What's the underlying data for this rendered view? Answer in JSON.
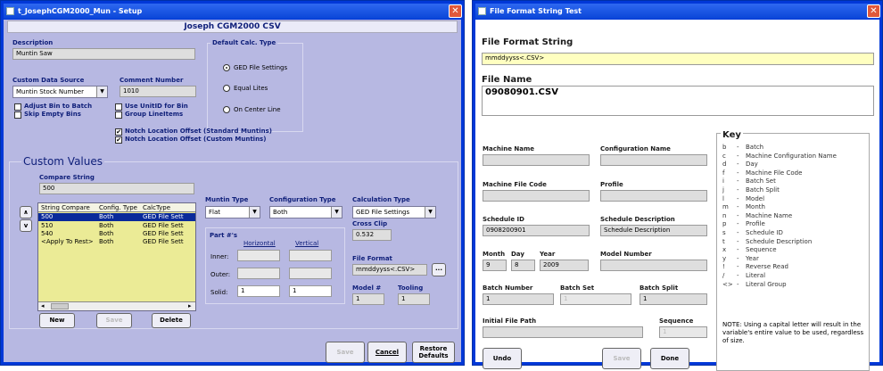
{
  "setup": {
    "title": "t_JosephCGM2000_Mun - Setup",
    "header": "Joseph CGM2000 CSV",
    "description_label": "Description",
    "description_value": "Muntin Saw",
    "default_calc_label": "Default Calc. Type",
    "calc_options": [
      "GED File Settings",
      "Equal Lites",
      "On Center Line"
    ],
    "custom_source_label": "Custom Data Source",
    "custom_source_value": "Muntin Stock Number",
    "comment_label": "Comment Number",
    "comment_value": "1010",
    "checks": [
      "Adjust Bin to Batch",
      "Skip Empty Bins",
      "Use UnitID for Bin",
      "Group LineItems",
      "Notch Location Offset (Standard Muntins)",
      "Notch Location Offset (Custom Muntins)"
    ],
    "custom_values_label": "Custom Values",
    "compare_label": "Compare String",
    "compare_value": "500",
    "grid_headers": [
      "String Compare",
      "Config. Type",
      "CalcType"
    ],
    "grid_rows": [
      [
        "500",
        "Both",
        "GED File Sett"
      ],
      [
        "510",
        "Both",
        "GED File Sett"
      ],
      [
        "540",
        "Both",
        "GED File Sett"
      ],
      [
        "<Apply To Rest>",
        "Both",
        "GED File Sett"
      ]
    ],
    "muntin_type_label": "Muntin Type",
    "muntin_type_value": "Flat",
    "config_type_label": "Configuration Type",
    "config_type_value": "Both",
    "calc_type_label": "Calculation Type",
    "calc_type_value": "GED File Settings",
    "part_label": "Part #'s",
    "horizontal_label": "Horizontal",
    "vertical_label": "Vertical",
    "inner_label": "Inner:",
    "outer_label": "Outer:",
    "solid_label": "Solid:",
    "solid_h": "1",
    "solid_v": "1",
    "cross_clip_label": "Cross Clip",
    "cross_clip_value": "0.532",
    "file_format_label": "File Format",
    "file_format_value": "mmddyyss<.CSV>",
    "model_label": "Model #",
    "model_value": "1",
    "tooling_label": "Tooling",
    "tooling_value": "1",
    "new_btn": "New",
    "save_btn": "Save",
    "delete_btn": "Delete",
    "cancel_btn": "Cancel",
    "restore_btn1": "Restore",
    "restore_btn2": "Defaults",
    "browse": "..."
  },
  "test": {
    "title": "File Format String Test",
    "ffs_label": "File Format String",
    "ffs_value": "mmddyyss<.CSV>",
    "fname_label": "File Name",
    "fname_value": "09080901.CSV",
    "machine_name": "Machine Name",
    "config_name": "Configuration Name",
    "machine_file": "Machine File Code",
    "profile": "Profile",
    "schedule_id": "Schedule ID",
    "schedule_id_value": "0908200901",
    "schedule_desc": "Schedule Description",
    "schedule_desc_value": "Schedule Description",
    "month": "Month",
    "month_value": "9",
    "day": "Day",
    "day_value": "8",
    "year": "Year",
    "year_value": "2009",
    "model_number": "Model Number",
    "batch_number": "Batch Number",
    "batch_number_value": "1",
    "batch_set": "Batch Set",
    "batch_set_value": "1",
    "batch_split": "Batch Split",
    "batch_split_value": "1",
    "initial_path": "Initial File Path",
    "sequence": "Sequence",
    "sequence_value": "1",
    "undo": "Undo",
    "save": "Save",
    "done": "Done",
    "key_title": "Key",
    "keys": [
      [
        "b",
        "Batch"
      ],
      [
        "c",
        "Machine Configuration Name"
      ],
      [
        "d",
        "Day"
      ],
      [
        "f",
        "Machine File Code"
      ],
      [
        "i",
        "Batch Set"
      ],
      [
        "j",
        "Batch Split"
      ],
      [
        "l",
        "Model"
      ],
      [
        "m",
        "Month"
      ],
      [
        "n",
        "Machine Name"
      ],
      [
        "p",
        "Profile"
      ],
      [
        "s",
        "Schedule ID"
      ],
      [
        "t",
        "Schedule Description"
      ],
      [
        "x",
        "Sequence"
      ],
      [
        "y",
        "Year"
      ],
      [
        "!",
        "Reverse Read"
      ],
      [
        "/",
        "Literal"
      ],
      [
        "<>",
        "Literal Group"
      ]
    ],
    "note": "NOTE:  Using a capital letter will result in the variable's entire value to be used, regardless of size."
  }
}
